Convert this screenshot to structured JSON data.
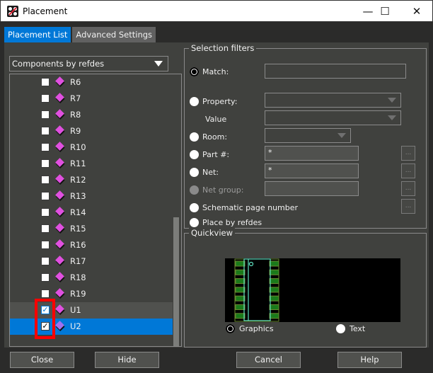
{
  "window": {
    "title": "Placement",
    "controls": {
      "minimize": "—",
      "maximize": "☐",
      "close": "✕"
    }
  },
  "tabs": [
    {
      "label": "Placement List",
      "active": true
    },
    {
      "label": "Advanced Settings",
      "active": false
    }
  ],
  "list_mode": {
    "selected": "Components by refdes"
  },
  "components": [
    {
      "refdes": "R6",
      "checked": false
    },
    {
      "refdes": "R7",
      "checked": false
    },
    {
      "refdes": "R8",
      "checked": false
    },
    {
      "refdes": "R9",
      "checked": false
    },
    {
      "refdes": "R10",
      "checked": false
    },
    {
      "refdes": "R11",
      "checked": false
    },
    {
      "refdes": "R12",
      "checked": false
    },
    {
      "refdes": "R13",
      "checked": false
    },
    {
      "refdes": "R14",
      "checked": false
    },
    {
      "refdes": "R15",
      "checked": false
    },
    {
      "refdes": "R16",
      "checked": false
    },
    {
      "refdes": "R17",
      "checked": false
    },
    {
      "refdes": "R18",
      "checked": false
    },
    {
      "refdes": "R19",
      "checked": false
    },
    {
      "refdes": "U1",
      "checked": true,
      "state": "hover"
    },
    {
      "refdes": "U2",
      "checked": true,
      "state": "selected"
    }
  ],
  "selection_filters": {
    "title": "Selection filters",
    "match": {
      "label": "Match:",
      "value": "",
      "selected": true
    },
    "property": {
      "label": "Property:",
      "value": ""
    },
    "value": {
      "label": "Value",
      "value": ""
    },
    "room": {
      "label": "Room:",
      "value": ""
    },
    "part": {
      "label": "Part #:",
      "value": "*",
      "browse": "..."
    },
    "net": {
      "label": "Net:",
      "value": "*",
      "browse": "..."
    },
    "net_group": {
      "label": "Net group:",
      "value": "",
      "browse": "...",
      "disabled": true
    },
    "schematic_page": {
      "label": "Schematic page number",
      "browse": "..."
    },
    "place_by_refdes": {
      "label": "Place by refdes"
    }
  },
  "quickview": {
    "title": "Quickview",
    "graphics_label": "Graphics",
    "text_label": "Text",
    "mode": "Graphics",
    "colors": {
      "pad": "#1a7a1a",
      "outline": "#5fe0c0",
      "pad_border": "#6a8a30"
    }
  },
  "buttons": {
    "close": "Close",
    "hide": "Hide",
    "cancel": "Cancel",
    "help": "Help"
  }
}
